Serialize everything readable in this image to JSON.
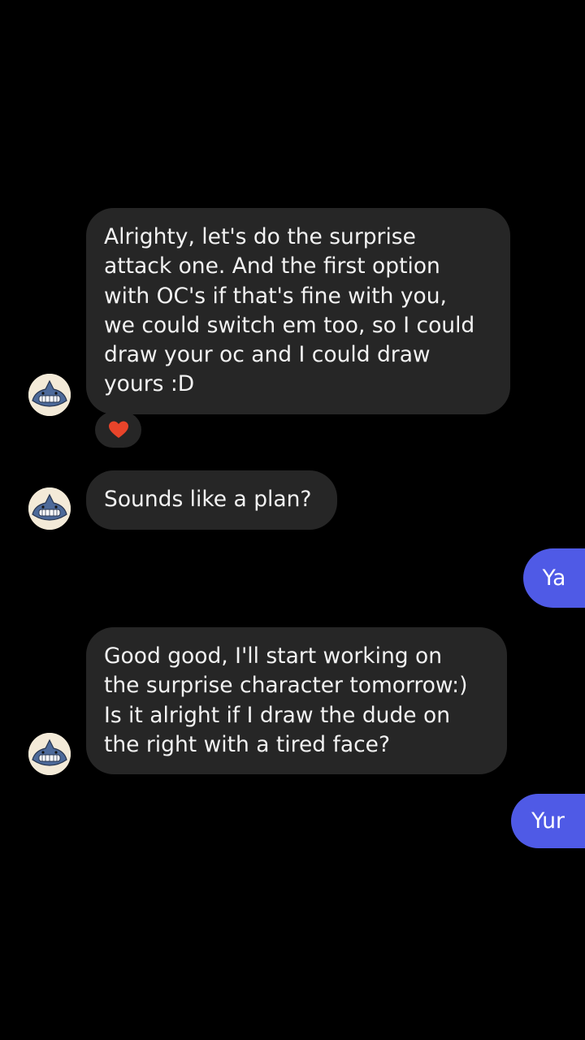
{
  "messages": [
    {
      "from": "them",
      "text": "Alrighty, let's do the surprise\nattack one. And the first option\nwith OC's if that's fine with you,\nwe could switch em too, so I could\ndraw your oc and I could draw\nyours :D",
      "reaction": "heart"
    },
    {
      "from": "them",
      "text": "Sounds like a plan?"
    },
    {
      "from": "me",
      "text": "Ya"
    },
    {
      "from": "them",
      "text": "Good good, I'll start working on\nthe surprise character tomorrow:)\nIs it alright if I draw the dude on\nthe right with a tired face?"
    },
    {
      "from": "me",
      "text": "Yur"
    }
  ],
  "colors": {
    "background": "#000000",
    "incoming_bubble": "#262626",
    "outgoing_bubble": "#4f5ae6",
    "reaction_heart": "#e8442a"
  },
  "icons": {
    "avatar": "shark-avatar-icon",
    "reaction": "heart-icon"
  }
}
